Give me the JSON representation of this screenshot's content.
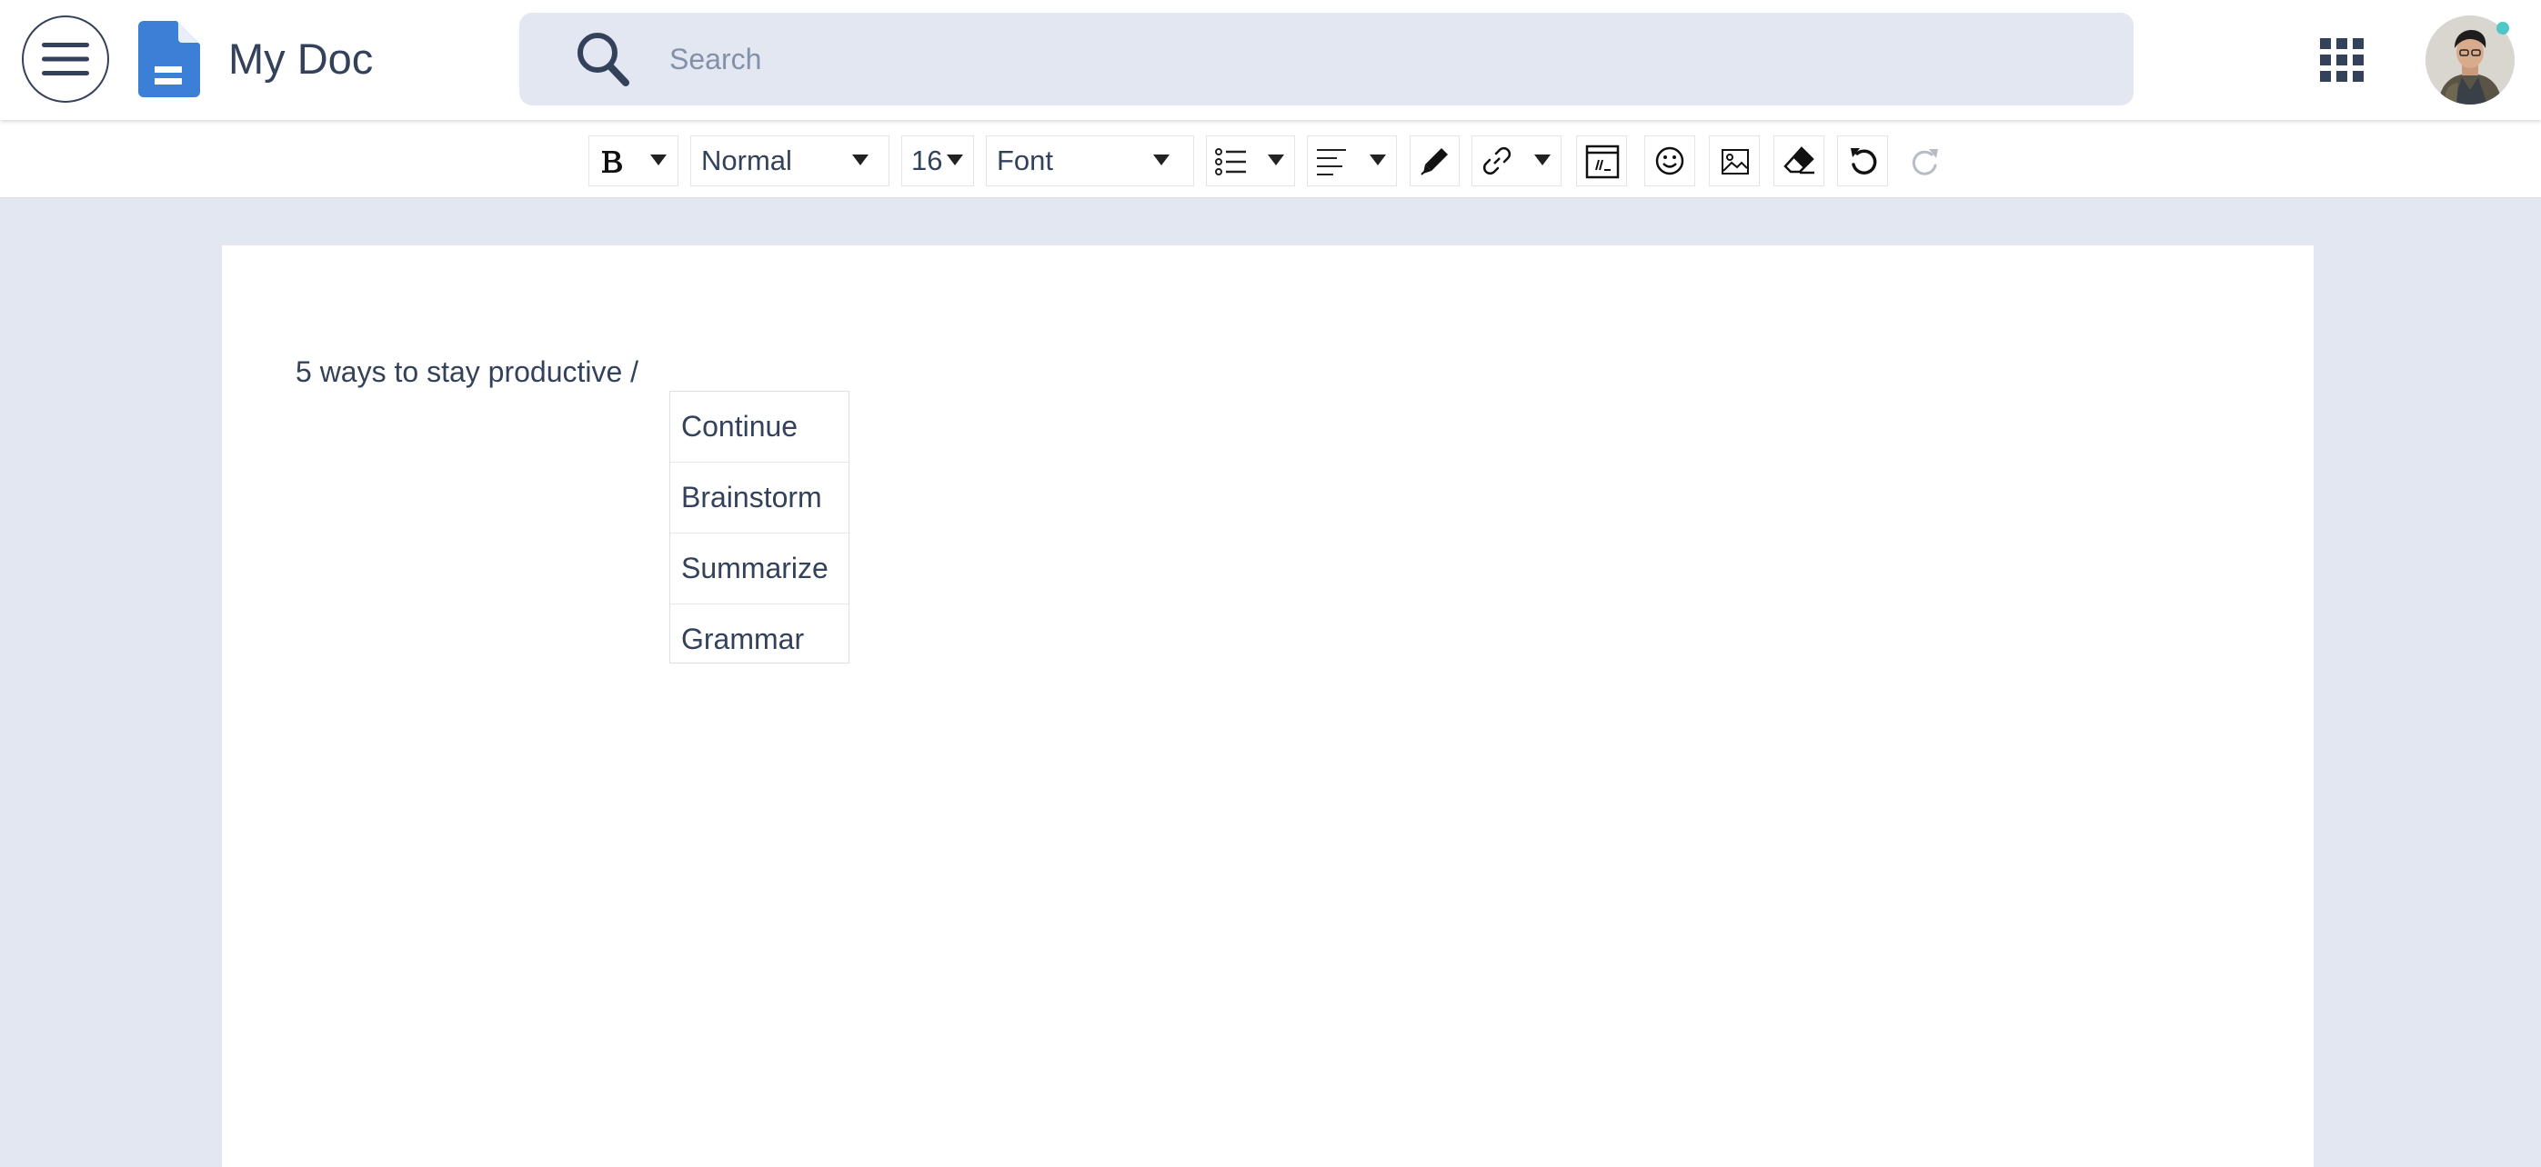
{
  "header": {
    "title": "My Doc",
    "search_placeholder": "Search"
  },
  "toolbar": {
    "block_style": "Normal",
    "font_size": "16",
    "font_family": "Font"
  },
  "document": {
    "text": "5 ways to stay productive /"
  },
  "ai_menu": {
    "items": [
      {
        "label": "Continue"
      },
      {
        "label": "Brainstorm"
      },
      {
        "label": "Summarize"
      },
      {
        "label": "Grammar"
      }
    ]
  },
  "colors": {
    "brand": "#3b7fd6",
    "text": "#33425a",
    "background": "#e3e7f1",
    "online_status": "#4fc7c6"
  },
  "icons": {
    "menu": "hamburger-icon",
    "doc": "document-icon",
    "search": "search-icon",
    "apps": "grid-icon"
  }
}
